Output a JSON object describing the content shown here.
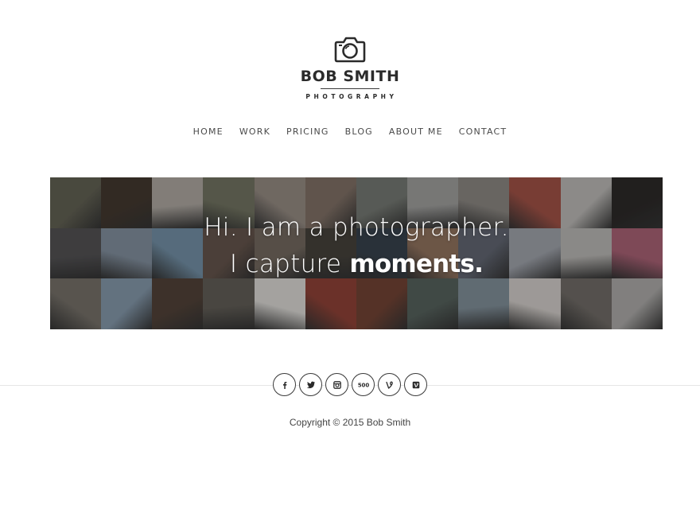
{
  "header": {
    "brand_name": "BOB SMITH",
    "brand_sub": "PHOTOGRAPHY",
    "logo_icon": "camera-icon"
  },
  "nav": {
    "items": [
      {
        "label": "HOME"
      },
      {
        "label": "WORK"
      },
      {
        "label": "PRICING"
      },
      {
        "label": "BLOG"
      },
      {
        "label": "ABOUT ME"
      },
      {
        "label": "CONTACT"
      }
    ]
  },
  "hero": {
    "line1": "Hi. I am a photographer.",
    "line2_prefix": "I capture ",
    "line2_emphasis": "moments.",
    "photo_mosaic_tones": [
      "#5b5a4c",
      "#3b3026",
      "#a9a39c",
      "#6b6d5a",
      "#8f857c",
      "#7a6a5f",
      "#6e726c",
      "#9a9a98",
      "#85817c",
      "#9b4a3e",
      "#b7b5b2",
      "#23201f",
      "#4b4a4c",
      "#7c8a99",
      "#6c8aa1",
      "#5e4d44",
      "#6c6258",
      "#3e3a33",
      "#2f3a45",
      "#8b6c57",
      "#5a5f6b",
      "#9a9ea6",
      "#b5b3b0",
      "#a45a6e",
      "#6f6a62",
      "#7e93a6",
      "#4a3a30",
      "#5a564f",
      "#d8d6d2",
      "#8a3a2e",
      "#6b3b2c",
      "#4e5a55",
      "#7b8a94",
      "#cfcac6",
      "#6a6560",
      "#a8a6a4"
    ]
  },
  "social": {
    "links": [
      {
        "icon": "facebook-icon"
      },
      {
        "icon": "twitter-icon"
      },
      {
        "icon": "instagram-icon"
      },
      {
        "icon": "500px-icon"
      },
      {
        "icon": "vine-icon"
      },
      {
        "icon": "vimeo-icon"
      }
    ]
  },
  "footer": {
    "copyright": "Copyright © 2015 Bob Smith"
  },
  "colors": {
    "text": "#333333",
    "divider": "#e6e6e6",
    "hero_text": "#ffffff"
  }
}
